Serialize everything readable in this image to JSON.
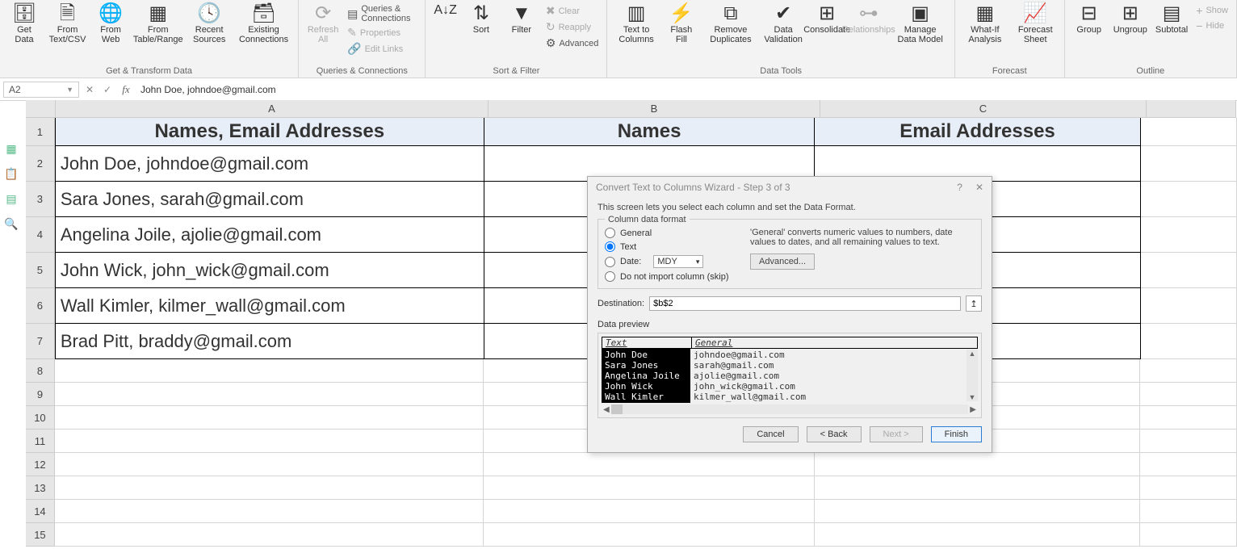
{
  "ribbon": {
    "groups": {
      "get_transform": {
        "label": "Get & Transform Data",
        "items": [
          "Get Data",
          "From Text/CSV",
          "From Web",
          "From Table/Range",
          "Recent Sources",
          "Existing Connections"
        ]
      },
      "queries": {
        "label": "Queries & Connections",
        "refresh": "Refresh All",
        "mini": [
          "Queries & Connections",
          "Properties",
          "Edit Links"
        ]
      },
      "sort_filter": {
        "label": "Sort & Filter",
        "sort": "Sort",
        "filter": "Filter",
        "mini": [
          "Clear",
          "Reapply",
          "Advanced"
        ]
      },
      "data_tools": {
        "label": "Data Tools",
        "items": [
          "Text to Columns",
          "Flash Fill",
          "Remove Duplicates",
          "Data Validation",
          "Consolidate",
          "Relationships",
          "Manage Data Model"
        ]
      },
      "forecast": {
        "label": "Forecast",
        "items": [
          "What-If Analysis",
          "Forecast Sheet"
        ]
      },
      "outline": {
        "label": "Outline",
        "items": [
          "Group",
          "Ungroup",
          "Subtotal"
        ],
        "mini": [
          "Show",
          "Hide"
        ]
      }
    }
  },
  "formulabar": {
    "cell_ref": "A2",
    "value": "John Doe, johndoe@gmail.com"
  },
  "columns": {
    "A": "A",
    "B": "B",
    "C": "C",
    "D": ""
  },
  "headers": {
    "A": "Names, Email Addresses",
    "B": "Names",
    "C": "Email Addresses"
  },
  "rows": [
    {
      "n": "2",
      "A": "John Doe, johndoe@gmail.com"
    },
    {
      "n": "3",
      "A": "Sara Jones, sarah@gmail.com"
    },
    {
      "n": "4",
      "A": "Angelina Joile, ajolie@gmail.com"
    },
    {
      "n": "5",
      "A": "John Wick, john_wick@gmail.com"
    },
    {
      "n": "6",
      "A": "Wall Kimler, kilmer_wall@gmail.com"
    },
    {
      "n": "7",
      "A": "Brad Pitt, braddy@gmail.com"
    }
  ],
  "empty_rows": [
    "8",
    "9",
    "10",
    "11",
    "12",
    "13",
    "14",
    "15"
  ],
  "dialog": {
    "title": "Convert Text to Columns Wizard - Step 3 of 3",
    "desc": "This screen lets you select each column and set the Data Format.",
    "fieldset": "Column data format",
    "opts": {
      "general": "General",
      "text": "Text",
      "date": "Date:",
      "date_fmt": "MDY",
      "skip": "Do not import column (skip)"
    },
    "side": "'General' converts numeric values to numbers, date values to dates, and all remaining values to text.",
    "advanced": "Advanced...",
    "dest_label": "Destination:",
    "dest_value": "$b$2",
    "preview_label": "Data preview",
    "pv_heads": {
      "c1": "Text",
      "c2": "General"
    },
    "pv_rows": [
      {
        "c1": "John Doe",
        "c2": "johndoe@gmail.com"
      },
      {
        "c1": "Sara Jones",
        "c2": "sarah@gmail.com"
      },
      {
        "c1": "Angelina Joile",
        "c2": "ajolie@gmail.com"
      },
      {
        "c1": "John Wick",
        "c2": "john_wick@gmail.com"
      },
      {
        "c1": "Wall Kimler",
        "c2": "kilmer_wall@gmail.com"
      }
    ],
    "btns": {
      "cancel": "Cancel",
      "back": "< Back",
      "next": "Next >",
      "finish": "Finish"
    }
  }
}
